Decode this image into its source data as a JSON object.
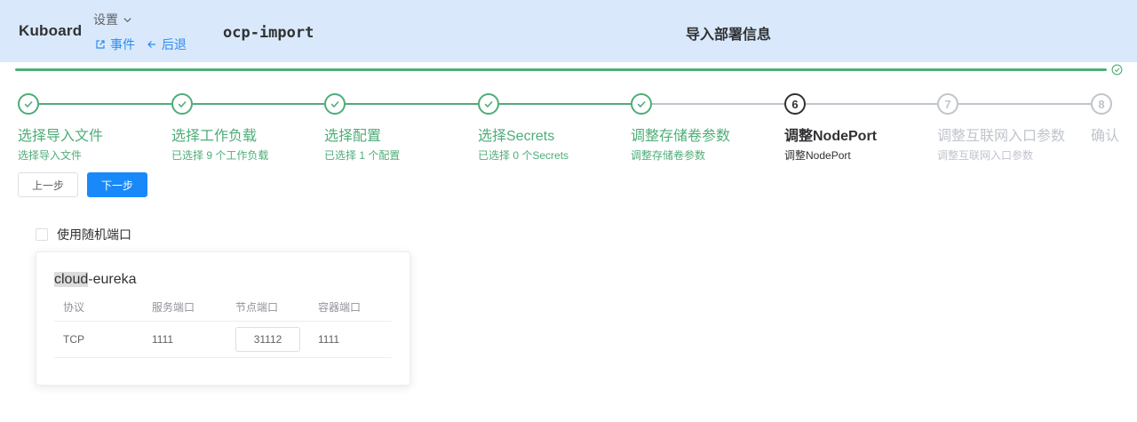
{
  "header": {
    "brand": "Kuboard",
    "settings_label": "设置",
    "links": [
      {
        "label": "事件",
        "icon": "external-link-icon"
      },
      {
        "label": "后退",
        "icon": "arrow-left-icon"
      }
    ],
    "app_name": "ocp-import",
    "page_title": "导入部署信息"
  },
  "progress": {
    "percent": 100,
    "status": "success",
    "color": "#4ead78"
  },
  "steps": [
    {
      "index": "1",
      "title": "选择导入文件",
      "desc": "选择导入文件",
      "status": "done"
    },
    {
      "index": "2",
      "title": "选择工作负载",
      "desc": "已选择 9 个工作负载",
      "status": "done"
    },
    {
      "index": "3",
      "title": "选择配置",
      "desc": "已选择 1 个配置",
      "status": "done"
    },
    {
      "index": "4",
      "title": "选择Secrets",
      "desc": "已选择 0 个Secrets",
      "status": "done"
    },
    {
      "index": "5",
      "title": "调整存储卷参数",
      "desc": "调整存储卷参数",
      "status": "done"
    },
    {
      "index": "6",
      "title": "调整NodePort",
      "desc": "调整NodePort",
      "status": "active"
    },
    {
      "index": "7",
      "title": "调整互联网入口参数",
      "desc": "调整互联网入口参数",
      "status": "todo"
    },
    {
      "index": "8",
      "title": "确认",
      "desc": "",
      "status": "todo"
    }
  ],
  "buttons": {
    "prev": "上一步",
    "next": "下一步"
  },
  "random_port": {
    "label": "使用随机端口",
    "checked": false
  },
  "card": {
    "title_highlight": "cloud",
    "title_rest": "-eureka",
    "columns": [
      "协议",
      "服务端口",
      "节点端口",
      "容器端口"
    ],
    "rows": [
      {
        "protocol": "TCP",
        "service_port": "1111",
        "node_port": "31112",
        "container_port": "1111"
      }
    ]
  },
  "colors": {
    "header_bg": "#d9e9fb",
    "success": "#4ead78",
    "primary": "#1989fa",
    "inactive": "#c0c4cc"
  }
}
